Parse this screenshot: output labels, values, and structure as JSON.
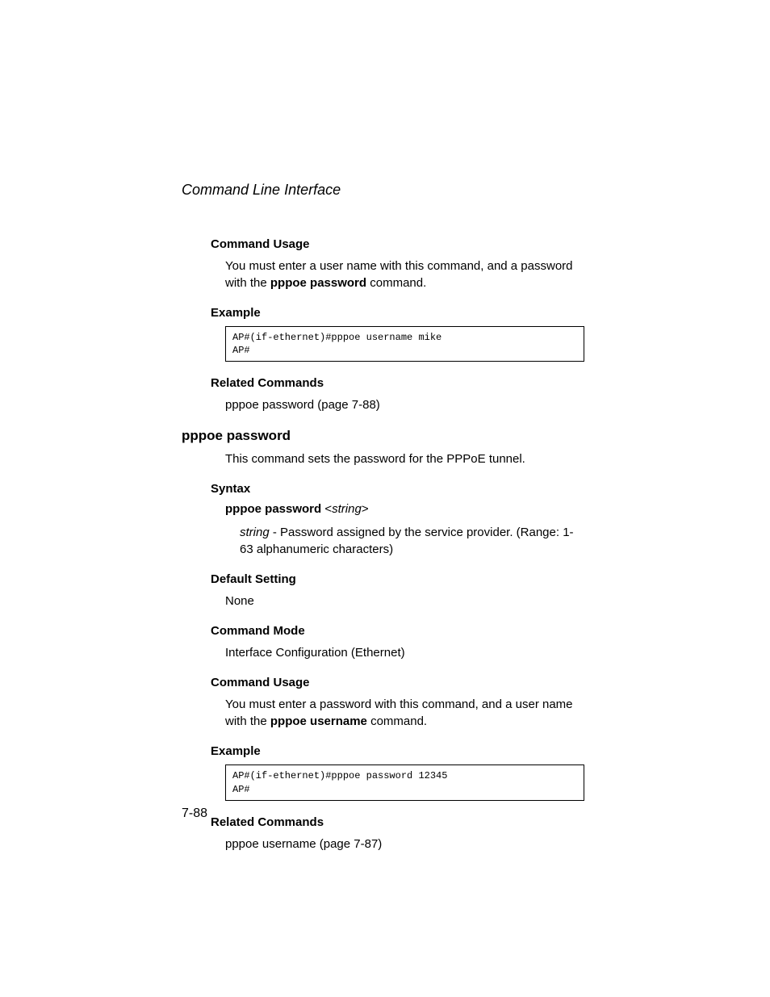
{
  "chapter_title": "Command Line Interface",
  "section1": {
    "command_usage_heading": "Command Usage",
    "command_usage_text_pre": "You must enter a user name with this command, and a password with the ",
    "command_usage_bold": "pppoe password",
    "command_usage_text_post": " command.",
    "example_heading": "Example",
    "example_code": "AP#(if-ethernet)#pppoe username mike\nAP#",
    "related_heading": "Related Commands",
    "related_text": "pppoe password (page 7-88)"
  },
  "section2": {
    "title": "pppoe password",
    "intro": "This command sets the password for the PPPoE tunnel.",
    "syntax_heading": "Syntax",
    "syntax_cmd": "pppoe password",
    "syntax_angle_open": " <",
    "syntax_param": "string",
    "syntax_angle_close": ">",
    "param_name": "string",
    "param_desc": " - Password assigned by the service provider. (Range: 1-63 alphanumeric characters)",
    "default_heading": "Default Setting",
    "default_value": "None",
    "mode_heading": "Command Mode",
    "mode_value": "Interface Configuration (Ethernet)",
    "command_usage_heading": "Command Usage",
    "command_usage_text_pre": "You must enter a password with this command, and a user name with the ",
    "command_usage_bold": "pppoe username",
    "command_usage_text_post": " command.",
    "example_heading": "Example",
    "example_code": "AP#(if-ethernet)#pppoe password 12345\nAP#",
    "related_heading": "Related Commands",
    "related_text": "pppoe username (page 7-87)"
  },
  "page_number": "7-88"
}
